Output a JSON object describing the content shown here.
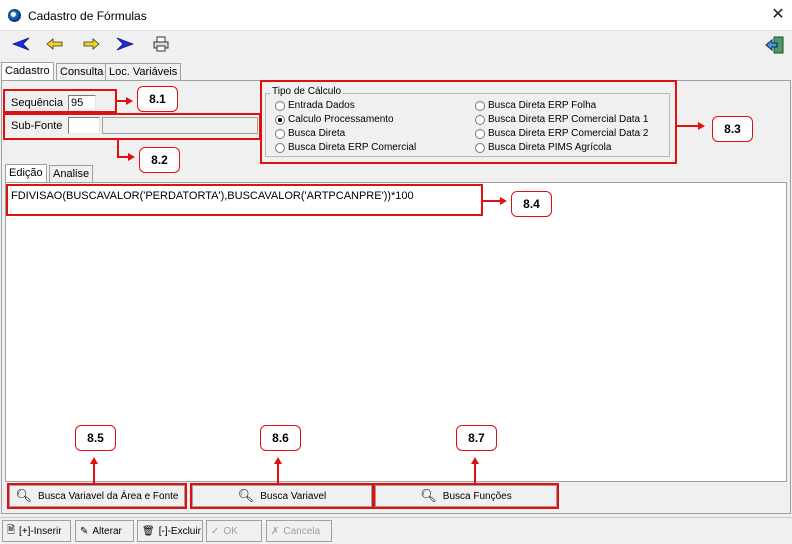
{
  "window": {
    "title": "Cadastro de Fórmulas"
  },
  "tabs": [
    "Cadastro",
    "Consulta",
    "Loc. Variáveis"
  ],
  "fields": {
    "sequencia_label": "Sequência",
    "sequencia_value": "95",
    "subfonte_label": "Sub-Fonte",
    "subfonte_value": "",
    "subfonte_desc": ""
  },
  "tipo_calculo": {
    "legend": "Tipo de Cálculo",
    "options": [
      "Entrada Dados",
      "Calculo Processamento",
      "Busca Direta",
      "Busca Direta ERP Comercial",
      "Busca Direta ERP Folha",
      "Busca Direta ERP Comercial Data 1",
      "Busca Direta ERP Comercial Data 2",
      "Busca Direta PIMS Agrícola"
    ],
    "selected": "Calculo Processamento"
  },
  "inner_tabs": [
    "Edição",
    "Analise"
  ],
  "formula": "FDIVISAO(BUSCAVALOR('PERDATORTA'),BUSCAVALOR('ARTPCANPRE'))*100",
  "buttons": {
    "busca_area": "Busca Variavel da Área e Fonte",
    "busca_variavel": "Busca Variavel",
    "busca_funcoes": "Busca Funções"
  },
  "bottom_buttons": {
    "inserir": "[+]-Inserir",
    "alterar": "Alterar",
    "excluir": "[-]-Excluir",
    "ok": "OK",
    "cancela": "Cancela"
  },
  "callouts": [
    "8.1",
    "8.2",
    "8.3",
    "8.4",
    "8.5",
    "8.6",
    "8.7"
  ],
  "colors": {
    "annotation_red": "#e01010",
    "nav_blue": "#1a2fd6"
  },
  "icons": {
    "toolbar": [
      "first-record-icon",
      "previous-record-icon",
      "next-record-icon",
      "last-record-icon",
      "print-icon",
      "exit-icon"
    ]
  }
}
